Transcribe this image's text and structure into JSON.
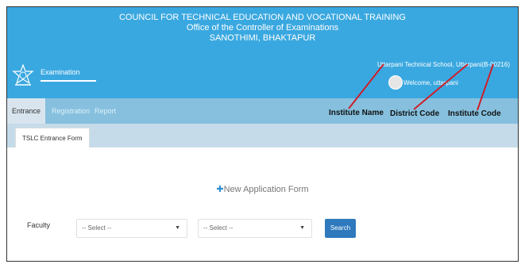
{
  "header": {
    "title_line1": "COUNCIL FOR TECHNICAL EDUCATION AND VOCATIONAL TRAINING",
    "title_line2": "Office of the Controller of Examinations",
    "title_line3": "SANOTHIMI, BHAKTAPUR",
    "section_label": "Examination",
    "school_info": "Uttarpani Technical School, Uttarpani(B-00216)",
    "welcome_text": "Welcome, uttarpani",
    "logo_icon": "emblem-icon",
    "avatar_icon": "user-avatar-icon"
  },
  "nav": {
    "tabs": [
      {
        "label": "Entrance",
        "active": true
      },
      {
        "label": "Registration",
        "active": false
      },
      {
        "label": "Report",
        "active": false
      }
    ]
  },
  "annotations": {
    "institute_name": "Institute Name",
    "district_code": "District Code",
    "institute_code": "Institute Code",
    "arrow_color": "#cc1f2a"
  },
  "subnav": {
    "tab_label": "TSLC Entrance Form"
  },
  "main": {
    "new_application": "New Application Form",
    "plus_icon": "plus-icon",
    "faculty_label": "Faculty",
    "select1_value": "-- Select --",
    "select2_value": "-- Select --",
    "search_label": "Search"
  },
  "colors": {
    "header_bg": "#3aa8e0",
    "nav_bg": "#86c0de",
    "subnav_bg": "#c5dbe9",
    "button_bg": "#2f79bd"
  }
}
